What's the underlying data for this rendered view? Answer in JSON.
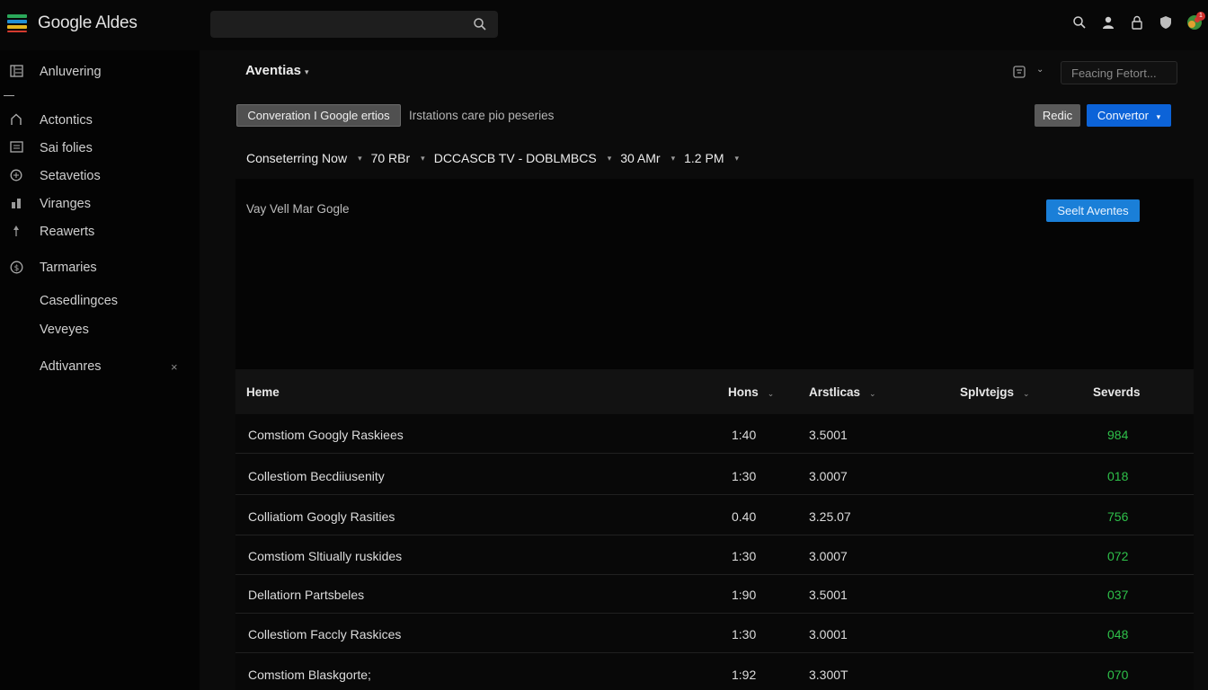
{
  "app": {
    "title": "Google Aldes",
    "logo_colors": [
      "#2aa85a",
      "#1f8fd4",
      "#e4b61f",
      "#d43a2f"
    ],
    "search_icon": "search-icon"
  },
  "topbar": {
    "icons": [
      "search-icon",
      "account-icon",
      "lock-icon",
      "shield-icon",
      "avatar-icon"
    ],
    "badge": "1"
  },
  "sidebar": {
    "items": [
      {
        "label": "Anluvering",
        "icon": "grid-icon"
      },
      {
        "label": "Actontics",
        "icon": "home-icon"
      },
      {
        "label": "Sai folies",
        "icon": "list-icon"
      },
      {
        "label": "Setavetios",
        "icon": "globe-icon"
      },
      {
        "label": "Viranges",
        "icon": "chart-icon"
      },
      {
        "label": "Reawerts",
        "icon": "pin-icon"
      },
      {
        "label": "Tarmaries",
        "icon": "dollar-icon"
      },
      {
        "label": "Casedlingces",
        "icon": ""
      },
      {
        "label": "Veveyes",
        "icon": ""
      },
      {
        "label": "Adtivanres",
        "icon": "",
        "close": "×"
      }
    ]
  },
  "header": {
    "title": "Aventias",
    "select_value": "Feacing Fetort..."
  },
  "toolbar": {
    "conversation_label": "Converation I Google ertios",
    "description": "Irstations care pio peseries",
    "redic_label": "Redic",
    "convertor_label": "Convertor"
  },
  "filters": [
    {
      "label": "Conseterring Now"
    },
    {
      "label": "70 RBr"
    },
    {
      "label": "DCCASCB TV - DOBLMBCS"
    },
    {
      "label": "30 AMr"
    },
    {
      "label": "1.2 PM"
    }
  ],
  "panel": {
    "text": "Vay Vell Mar Gogle",
    "button_label": "Seelt Aventes"
  },
  "table": {
    "headers": {
      "name": "Heme",
      "hons": "Hons",
      "arstlicas": "Arstlicas",
      "splvtejgs": "Splvtejgs",
      "severds": "Severds"
    },
    "rows": [
      {
        "name": "Comstiom Googly Raskiees",
        "hons": "1:40",
        "arstlicas": "3.5001",
        "severds": "984"
      },
      {
        "name": "Collestiom Becdiiusenity",
        "hons": "1:30",
        "arstlicas": "3.0007",
        "severds": "018"
      },
      {
        "name": "Colliatiom Googly Rasities",
        "hons": "0.40",
        "arstlicas": "3.25.07",
        "severds": "756"
      },
      {
        "name": "Comstiom Sltiually ruskides",
        "hons": "1:30",
        "arstlicas": "3.0007",
        "severds": "072"
      },
      {
        "name": "Dellatiorn Partsbeles",
        "hons": "1:90",
        "arstlicas": "3.5001",
        "severds": "037"
      },
      {
        "name": "Collestiom Faccly Raskices",
        "hons": "1:30",
        "arstlicas": "3.0001",
        "severds": "048"
      },
      {
        "name": "Comstiom Blaskgorte;",
        "hons": "1:92",
        "arstlicas": "3.300T",
        "severds": "070"
      }
    ]
  },
  "colors": {
    "accent": "#0c63d8",
    "accent_light": "#1a7fd8",
    "positive": "#2ec04a",
    "background": "#050505"
  }
}
